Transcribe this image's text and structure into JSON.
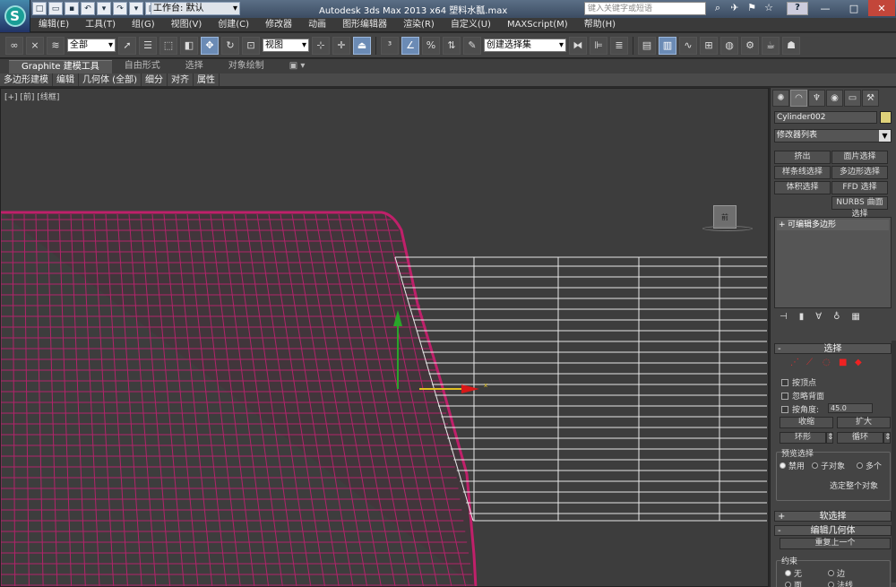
{
  "titlebar": {
    "workspace": "工作台: 默认",
    "app_title": "Autodesk 3ds Max  2013 x64      塑料水瓢.max",
    "search_placeholder": "键入关键字或短语",
    "help": "?",
    "minimize": "—",
    "maximize": "□",
    "close": "✕"
  },
  "menu": [
    "编辑(E)",
    "工具(T)",
    "组(G)",
    "视图(V)",
    "创建(C)",
    "修改器",
    "动画",
    "图形编辑器",
    "渲染(R)",
    "自定义(U)",
    "MAXScript(M)",
    "帮助(H)"
  ],
  "toolbar": {
    "filter": "全部",
    "refcoord": "视图",
    "selection_set": "创建选择集"
  },
  "ribbon": {
    "tabs": [
      "Graphite 建模工具",
      "自由形式",
      "选择",
      "对象绘制"
    ],
    "subtabs": [
      "多边形建模",
      "编辑",
      "几何体 (全部)",
      "细分",
      "对齐",
      "属性"
    ]
  },
  "viewport": {
    "label": "[+] [前] [线框]",
    "viewcube": "前"
  },
  "cmd": {
    "object_name": "Cylinder002",
    "object_color": "#dfd27a",
    "modifier_list": "修改器列表",
    "mod_buttons": [
      "挤出",
      "面片选择",
      "样条线选择",
      "多边形选择",
      "体积选择",
      "FFD 选择",
      "NURBS 曲面选择"
    ],
    "stack_item": "可编辑多边形",
    "sel_header": "选择",
    "by_vertex": "按顶点",
    "ignore_backfacing": "忽略背面",
    "by_angle": "按角度:",
    "angle_value": "45.0",
    "shrink": "收缩",
    "grow": "扩大",
    "ring": "环形",
    "loop": "循环",
    "preview_selection": "预览选择",
    "preview_options": [
      "禁用",
      "子对象",
      "多个"
    ],
    "whole_object": "选定整个对象",
    "soft_selection": "软选择",
    "edit_geometry": "编辑几何体",
    "repeat_last": "重复上一个",
    "constraints": "约束",
    "constraint_options": [
      "无",
      "边",
      "面",
      "法线"
    ]
  }
}
